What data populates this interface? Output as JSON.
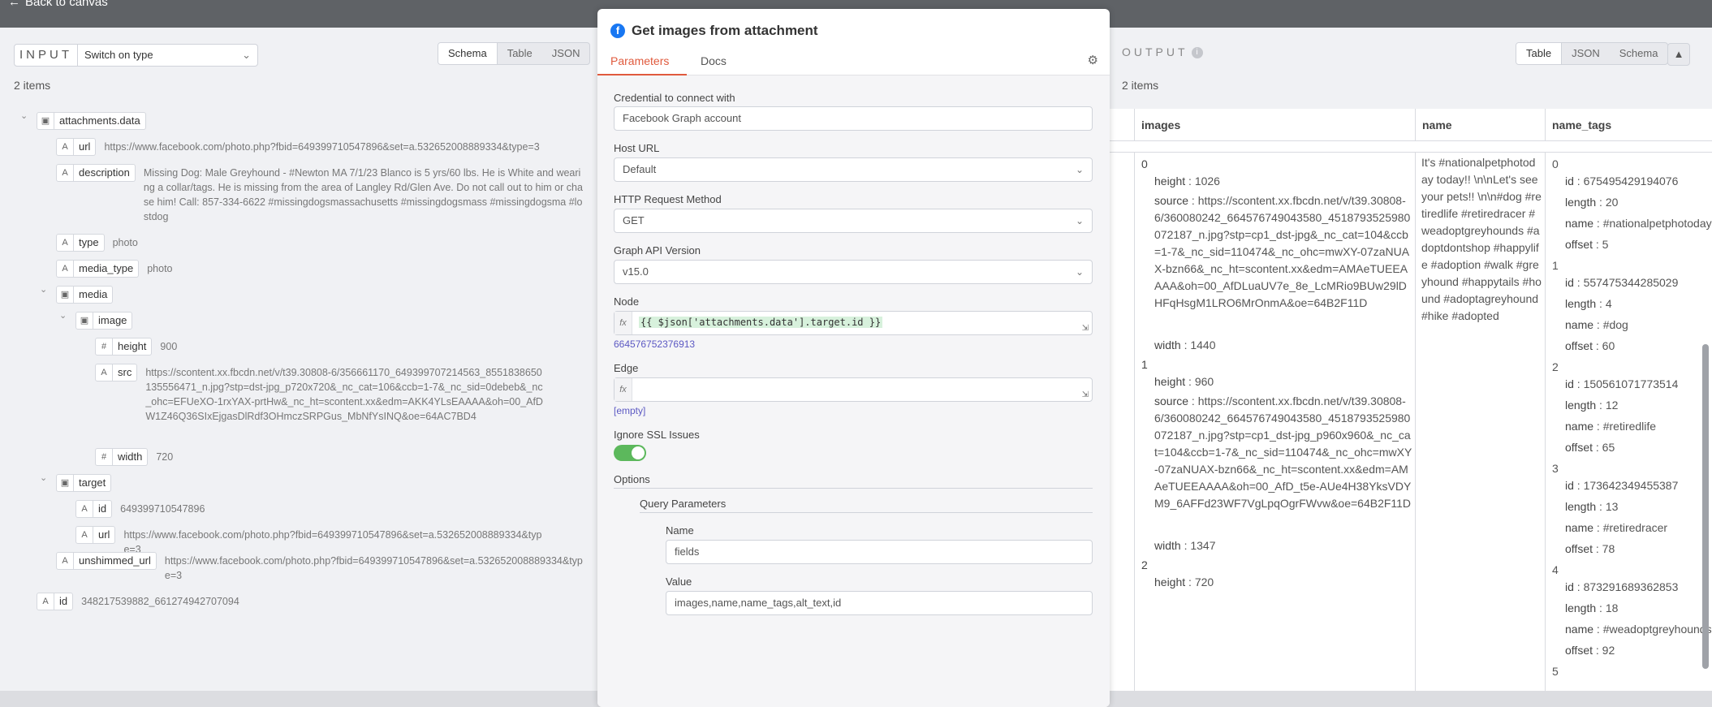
{
  "top": {
    "back_label": "Back to canvas"
  },
  "input": {
    "title": "INPUT",
    "selector": "Switch on type",
    "views": [
      "Schema",
      "Table",
      "JSON"
    ],
    "items_count": "2 items",
    "tree": [
      {
        "level": 0,
        "type": "cube",
        "key": "attachments.data",
        "value": "",
        "expanded": true
      },
      {
        "level": 1,
        "type": "A",
        "key": "url",
        "value": "https://www.facebook.com/photo.php?fbid=649399710547896&set=a.532652008889334&type=3"
      },
      {
        "level": 1,
        "type": "A",
        "key": "description",
        "value": "Missing Dog: Male Greyhound - #Newton MA 7/1/23 Blanco is 5 yrs/60 lbs. He is White and wearing a collar/tags. He is missing from the area of Langley Rd/Glen Ave. Do not call out to him or chase him! Call: 857-334-6622 #missingdogsmassachusetts #missingdogsmass #missingdogsma #lostdog"
      },
      {
        "level": 1,
        "type": "A",
        "key": "type",
        "value": "photo"
      },
      {
        "level": 1,
        "type": "A",
        "key": "media_type",
        "value": "photo"
      },
      {
        "level": 1,
        "type": "cube",
        "key": "media",
        "value": "",
        "expanded": true
      },
      {
        "level": 2,
        "type": "cube",
        "key": "image",
        "value": "",
        "expanded": true
      },
      {
        "level": 3,
        "type": "#",
        "key": "height",
        "value": "900"
      },
      {
        "level": 3,
        "type": "A",
        "key": "src",
        "value": "https://scontent.xx.fbcdn.net/v/t39.30808-6/356661170_649399707214563_8551838650135556471_n.jpg?stp=dst-jpg_p720x720&_nc_cat=106&ccb=1-7&_nc_sid=0debeb&_nc_ohc=EFUeXO-1rxYAX-prtHw&_nc_ht=scontent.xx&edm=AKK4YLsEAAAA&oh=00_AfDW1Z46Q36SIxEjgasDlRdf3OHmczSRPGus_MbNfYsINQ&oe=64AC7BD4"
      },
      {
        "level": 3,
        "type": "#",
        "key": "width",
        "value": "720"
      },
      {
        "level": 1,
        "type": "cube",
        "key": "target",
        "value": "",
        "expanded": true
      },
      {
        "level": 2,
        "type": "A",
        "key": "id",
        "value": "649399710547896"
      },
      {
        "level": 2,
        "type": "A",
        "key": "url",
        "value": "https://www.facebook.com/photo.php?fbid=649399710547896&set=a.532652008889334&type=3"
      },
      {
        "level": 1,
        "type": "A",
        "key": "unshimmed_url",
        "value": "https://www.facebook.com/photo.php?fbid=649399710547896&set=a.532652008889334&type=3"
      },
      {
        "level": 0,
        "type": "A",
        "key": "id",
        "value": "348217539882_661274942707094"
      }
    ]
  },
  "node": {
    "title": "Get images from attachment",
    "tabs": [
      "Parameters",
      "Docs"
    ],
    "credential_label": "Credential to connect with",
    "credential_value": "Facebook Graph account",
    "host_label": "Host URL",
    "host_value": "Default",
    "method_label": "HTTP Request Method",
    "method_value": "GET",
    "version_label": "Graph API Version",
    "version_value": "v15.0",
    "node_label": "Node",
    "node_expr": "{{ $json['attachments.data'].target.id }}",
    "node_hint": "664576752376913",
    "edge_label": "Edge",
    "edge_hint": "[empty]",
    "ssl_label": "Ignore SSL Issues",
    "ssl_on": true,
    "options_label": "Options",
    "query_label": "Query Parameters",
    "qp_name_label": "Name",
    "qp_name_value": "fields",
    "qp_value_label": "Value",
    "qp_value_value": "images,name,name_tags,alt_text,id",
    "fx_label": "fx"
  },
  "output": {
    "title": "OUTPUT",
    "views": [
      "Table",
      "JSON",
      "Schema"
    ],
    "items_count": "2 items",
    "columns": [
      "images",
      "name",
      "name_tags"
    ],
    "images_lines": [
      {
        "indent": 0,
        "text": "0"
      },
      {
        "indent": 1,
        "key": "height",
        "val": "1026"
      },
      {
        "indent": 1,
        "key": "source",
        "val": "https://scontent.xx.fbcdn.net/v/t39.30808-6/360080242_664576749043580_4518793525980072187_n.jpg?stp=cp1_dst-jpg&_nc_cat=104&ccb=1-7&_nc_sid=110474&_nc_ohc=mwXY-07zaNUAX-bzn66&_nc_ht=scontent.xx&edm=AMAeTUEEAAAA&oh=00_AfDLuaUV7e_8e_LcMRio9BUw29lDHFqHsgM1LRO6MrOnmA&oe=64B2F11D"
      },
      {
        "indent": 1,
        "key": "width",
        "val": "1440"
      },
      {
        "indent": 0,
        "text": "1"
      },
      {
        "indent": 1,
        "key": "height",
        "val": "960"
      },
      {
        "indent": 1,
        "key": "source",
        "val": "https://scontent.xx.fbcdn.net/v/t39.30808-6/360080242_664576749043580_4518793525980072187_n.jpg?stp=cp1_dst-jpg_p960x960&_nc_cat=104&ccb=1-7&_nc_sid=110474&_nc_ohc=mwXY-07zaNUAX-bzn66&_nc_ht=scontent.xx&edm=AMAeTUEEAAAA&oh=00_AfD_t5e-AUe4H38YksVDYM9_6AFFd23WF7VgLpqOgrFWvw&oe=64B2F11D"
      },
      {
        "indent": 1,
        "key": "width",
        "val": "1347"
      },
      {
        "indent": 0,
        "text": "2"
      },
      {
        "indent": 1,
        "key": "height",
        "val": "720"
      }
    ],
    "name_text": "It's #nationalpetphotoday today!! \\n\\nLet's see your pets!! \\n\\n#dog #retiredlife #retiredracer #weadoptgreyhounds #adoptdontshop #happylife #adoption #walk #greyhound #happytails #hound #adoptagreyhound #hike #adopted",
    "name_tags": [
      {
        "idx": "0",
        "id": "675495429194076",
        "length": "20",
        "name": "#nationalpetphotoday",
        "offset": "5"
      },
      {
        "idx": "1",
        "id": "557475344285029",
        "length": "4",
        "name": "#dog",
        "offset": "60"
      },
      {
        "idx": "2",
        "id": "150561071773514",
        "length": "12",
        "name": "#retiredlife",
        "offset": "65"
      },
      {
        "idx": "3",
        "id": "173642349455387",
        "length": "13",
        "name": "#retiredracer",
        "offset": "78"
      },
      {
        "idx": "4",
        "id": "873291689362853",
        "length": "18",
        "name": "#weadoptgreyhounds",
        "offset": "92"
      },
      {
        "idx": "5",
        "id": "",
        "length": "",
        "name": "",
        "offset": ""
      }
    ],
    "keys": {
      "id": "id",
      "length": "length",
      "name": "name",
      "offset": "offset",
      "height": "height",
      "source": "source",
      "width": "width"
    }
  }
}
